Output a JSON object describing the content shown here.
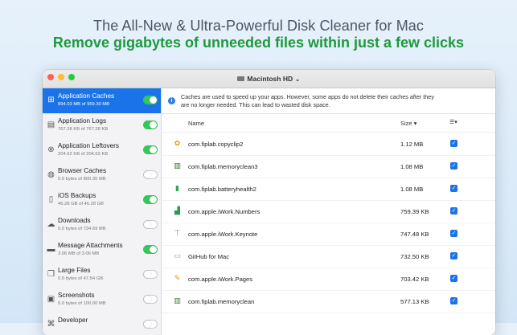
{
  "headline": {
    "line1": "The All-New & Ultra-Powerful Disk Cleaner for Mac",
    "line2": "Remove gigabytes of unneeded files within just a few clicks"
  },
  "window": {
    "title": "Macintosh HD ⌄"
  },
  "sidebar": {
    "items": [
      {
        "name": "Application Caches",
        "size": "894.03 MB of 959.30 MB",
        "icon": "grid-icon",
        "on": true,
        "active": true
      },
      {
        "name": "Application Logs",
        "size": "767.28 KB of 767.28 KB",
        "icon": "clipboard-icon",
        "on": true
      },
      {
        "name": "Application Leftovers",
        "size": "204.62 KB of 204.62 KB",
        "icon": "x-circle-icon",
        "on": true
      },
      {
        "name": "Browser Caches",
        "size": "0.0 bytes of 800.35 MB",
        "icon": "globe-icon",
        "on": false
      },
      {
        "name": "iOS Backups",
        "size": "46.28 GB of 46.28 GB",
        "icon": "phone-icon",
        "on": true
      },
      {
        "name": "Downloads",
        "size": "0.0 bytes of 734.69 MB",
        "icon": "cloud-download-icon",
        "on": false
      },
      {
        "name": "Message Attachments",
        "size": "3.06 MB of 3.06 MB",
        "icon": "message-icon",
        "on": true
      },
      {
        "name": "Large Files",
        "size": "0.0 bytes of 47.54 GB",
        "icon": "files-icon",
        "on": false
      },
      {
        "name": "Screenshots",
        "size": "0.0 bytes of 100.00 MB",
        "icon": "image-icon",
        "on": false
      },
      {
        "name": "Developer",
        "size": "",
        "icon": "code-icon",
        "on": false
      }
    ]
  },
  "main": {
    "info": "Caches are used to speed up your apps. However, some apps do not delete their caches after they are no longer needed. This can lead to wasted disk space.",
    "columns": {
      "name": "Name",
      "size": "Size ▾",
      "menu": "☰▾"
    },
    "rows": [
      {
        "name": "com.fiplab.copyclip2",
        "size": "1.12 MB",
        "icon": "copyclip-icon",
        "color": "#d69a1c"
      },
      {
        "name": "com.fiplab.memoryclean3",
        "size": "1.08 MB",
        "icon": "memory-chip-icon",
        "color": "#2b6b1f"
      },
      {
        "name": "com.fiplab.batteryhealth2",
        "size": "1.08 MB",
        "icon": "battery-icon",
        "color": "#2fa84f"
      },
      {
        "name": "com.apple.iWork.Numbers",
        "size": "759.39 KB",
        "icon": "numbers-icon",
        "color": "#2e9b4b"
      },
      {
        "name": "com.apple.iWork.Keynote",
        "size": "747.48 KB",
        "icon": "keynote-icon",
        "color": "#3b82f6"
      },
      {
        "name": "GitHub for Mac",
        "size": "732.50 KB",
        "icon": "folder-icon",
        "color": "#5aaaf0"
      },
      {
        "name": "com.apple.iWork.Pages",
        "size": "703.42 KB",
        "icon": "pages-icon",
        "color": "#f08a24"
      },
      {
        "name": "com.fiplab.memoryclean",
        "size": "577.13 KB",
        "icon": "memory-chip-icon",
        "color": "#3a7a2a"
      }
    ]
  },
  "colors": {
    "accent": "#1a73e8",
    "toggle_on": "#34c759",
    "headline_green": "#1e9a3c"
  }
}
